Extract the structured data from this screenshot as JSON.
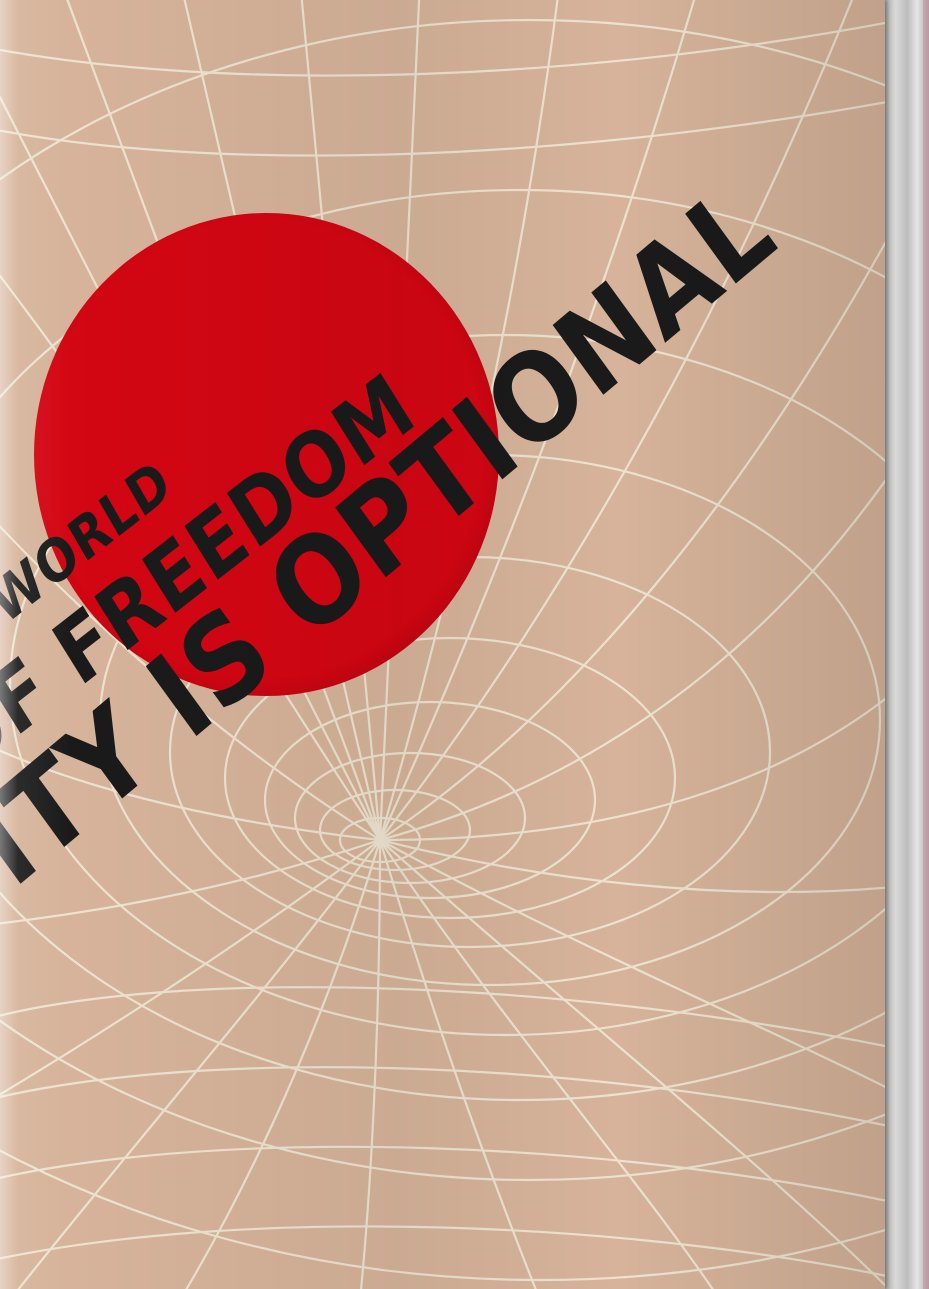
{
  "cover": {
    "line1": "WORLD",
    "line2": "OF FREEDOM",
    "line3": "VITY IS OPTIONAL",
    "colors": {
      "background": "#d6b39a",
      "sun": "#d30613",
      "grid": "#ece3cf",
      "text": "#1a1a1a"
    }
  }
}
